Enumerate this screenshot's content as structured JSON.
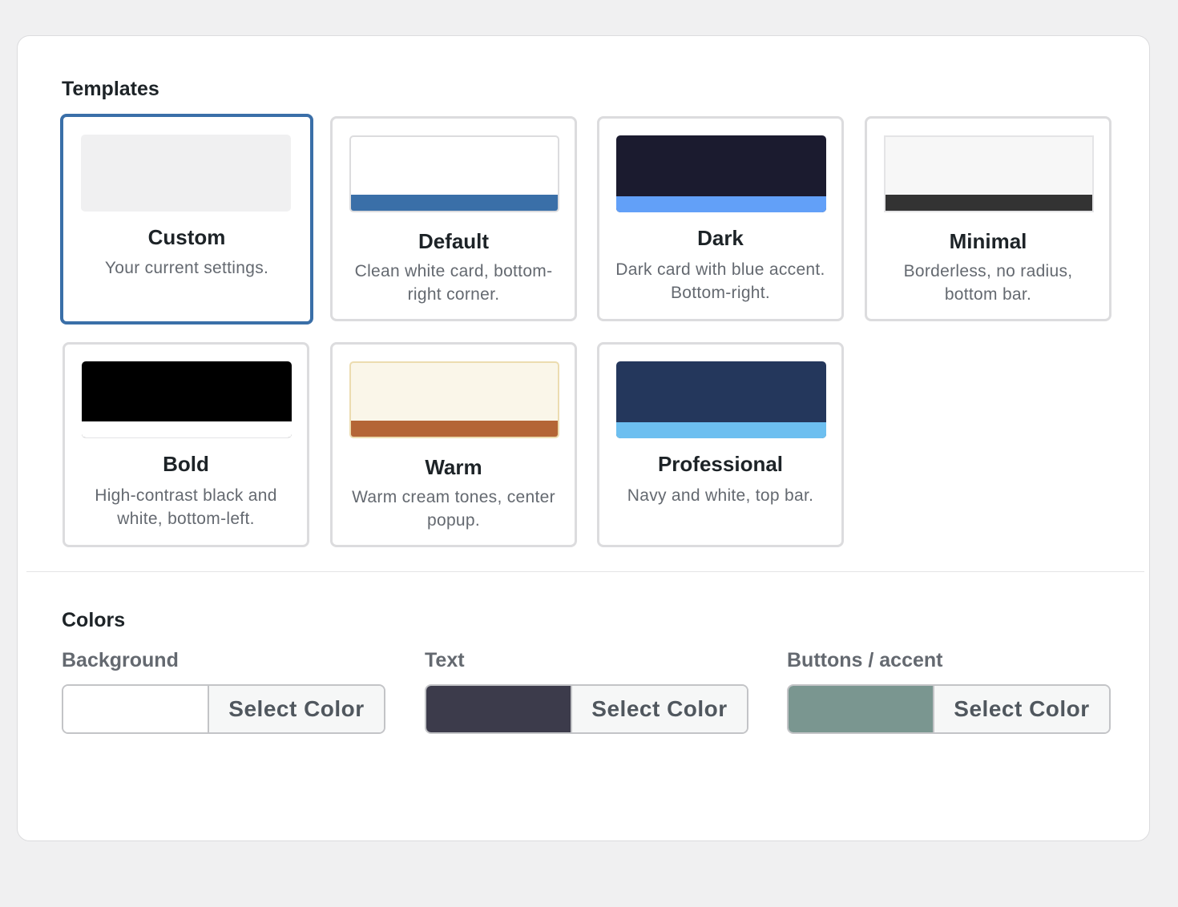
{
  "templates": {
    "title": "Templates",
    "items": [
      {
        "name": "Custom",
        "description": "Your current settings.",
        "swatch_color": "#f0f0f1",
        "bar_color": "",
        "selected": true
      },
      {
        "name": "Default",
        "description": "Clean white card, bottom-right corner.",
        "swatch_color": "#ffffff",
        "bar_color": "#3a6fa8",
        "selected": false
      },
      {
        "name": "Dark",
        "description": "Dark card with blue accent. Bottom-right.",
        "swatch_color": "#1b1b2f",
        "bar_color": "#62a0f8",
        "selected": false
      },
      {
        "name": "Minimal",
        "description": "Borderless, no radius, bottom bar.",
        "swatch_color": "#f7f7f7",
        "bar_color": "#333333",
        "selected": false
      },
      {
        "name": "Bold",
        "description": "High-contrast black and white, bottom-left.",
        "swatch_color": "#000000",
        "bar_color": "#ffffff",
        "selected": false
      },
      {
        "name": "Warm",
        "description": "Warm cream tones, center popup.",
        "swatch_color": "#faf6e9",
        "bar_color": "#b46536",
        "selected": false
      },
      {
        "name": "Professional",
        "description": "Navy and white, top bar.",
        "swatch_color": "#24375c",
        "bar_color": "#6dbff0",
        "selected": false
      }
    ]
  },
  "colors": {
    "title": "Colors",
    "fields": [
      {
        "label": "Background",
        "value_color": "#ffffff",
        "button_label": "Select Color"
      },
      {
        "label": "Text",
        "value_color": "#3c3b4b",
        "button_label": "Select Color"
      },
      {
        "label": "Buttons / accent",
        "value_color": "#7a9690",
        "button_label": "Select Color"
      }
    ]
  }
}
